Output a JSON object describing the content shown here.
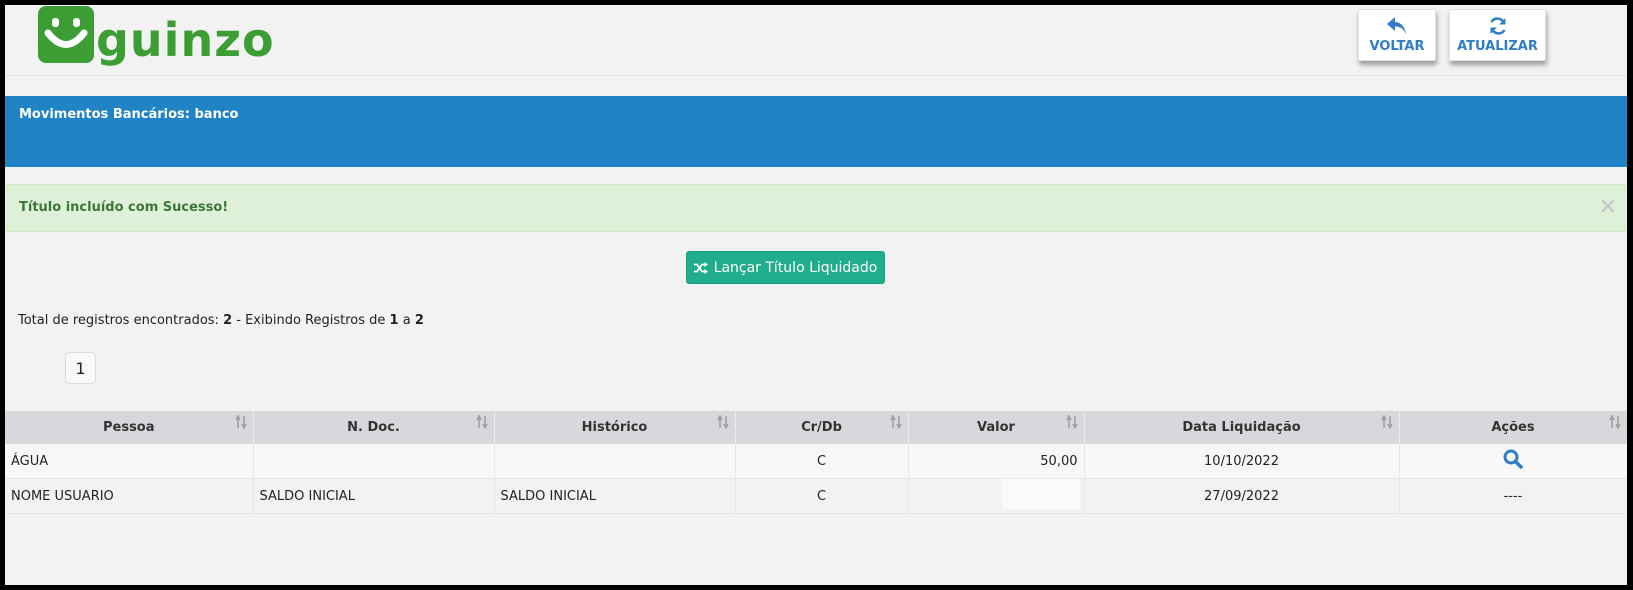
{
  "header": {
    "logo_text": "guinzo",
    "voltar_label": "VOLTAR",
    "atualizar_label": "ATUALIZAR",
    "brand_color": "#3c9d35"
  },
  "title_bar": {
    "title": "Movimentos Bancários: banco",
    "color": "#1f83c6"
  },
  "alert": {
    "message": "Título incluído com Sucesso!",
    "close_symbol": "×"
  },
  "actions": {
    "launch_label": "Lançar Título Liquidado"
  },
  "totals": {
    "prefix": "Total de registros encontrados:",
    "total": "2",
    "middle": "- Exibindo Registros de",
    "from": "1",
    "sep": "a",
    "to": "2"
  },
  "pagination": {
    "current_page": "1"
  },
  "table": {
    "headers": [
      "Pessoa",
      "N. Doc.",
      "Histórico",
      "Cr/Db",
      "Valor",
      "Data Liquidação",
      "Ações"
    ],
    "rows": [
      {
        "pessoa": "ÁGUA",
        "ndoc": "",
        "historico": "",
        "crdb": "C",
        "valor": "50,00",
        "data": "10/10/2022",
        "acoes_icon": "search-icon"
      },
      {
        "pessoa": "NOME USUARIO",
        "ndoc": "SALDO INICIAL",
        "historico": "SALDO INICIAL",
        "crdb": "C",
        "valor": "",
        "data": "27/09/2022",
        "acoes": "----"
      }
    ]
  }
}
